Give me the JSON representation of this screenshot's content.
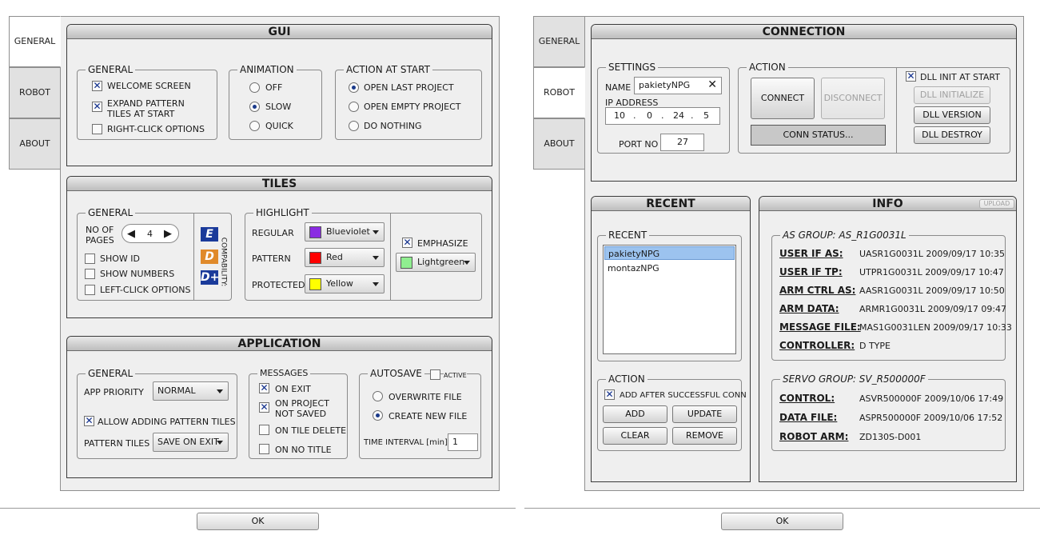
{
  "dialog_left": {
    "tabs": [
      {
        "label": "GENERAL",
        "active": true
      },
      {
        "label": "ROBOT",
        "active": false
      },
      {
        "label": "ABOUT",
        "active": false
      }
    ],
    "ok_label": "OK",
    "gui": {
      "title": "GUI",
      "general": {
        "title": "GENERAL",
        "welcome_screen": "WELCOME SCREEN",
        "expand_line1": "EXPAND PATTERN",
        "expand_line2": "TILES AT START",
        "right_click": "RIGHT-CLICK OPTIONS"
      },
      "animation": {
        "title": "ANIMATION",
        "off": "OFF",
        "slow": "SLOW",
        "quick": "QUICK",
        "selected": "SLOW"
      },
      "action_at_start": {
        "title": "ACTION AT START",
        "open_last": "OPEN LAST PROJECT",
        "open_empty": "OPEN EMPTY PROJECT",
        "do_nothing": "DO NOTHING",
        "selected": "OPEN LAST PROJECT"
      }
    },
    "tiles": {
      "title": "TILES",
      "general": {
        "title": "GENERAL",
        "no_of_pages_line1": "NO OF",
        "no_of_pages_line2": "PAGES",
        "pages_value": "4",
        "show_id": "SHOW ID",
        "show_numbers": "SHOW NUMBERS",
        "left_click": "LEFT-CLICK OPTIONS",
        "compatibility": "COMPABILITY:"
      },
      "highlight": {
        "title": "HIGHLIGHT",
        "regular_label": "REGULAR",
        "regular_value": "Blueviolet",
        "regular_color": "#8a2be2",
        "pattern_label": "PATTERN",
        "pattern_value": "Red",
        "pattern_color": "#ff0000",
        "protected_label": "PROTECTED",
        "protected_value": "Yellow",
        "protected_color": "#ffff00",
        "emphasize_label": "EMPHASIZE",
        "emphasize_value": "Lightgreen",
        "emphasize_color": "#90ee90"
      }
    },
    "application": {
      "title": "APPLICATION",
      "general": {
        "title": "GENERAL",
        "app_priority_label": "APP PRIORITY",
        "app_priority_value": "NORMAL",
        "allow_adding": "ALLOW ADDING PATTERN TILES",
        "pattern_tiles_label": "PATTERN TILES",
        "pattern_tiles_value": "SAVE ON EXIT"
      },
      "messages": {
        "title": "MESSAGES",
        "on_exit": "ON EXIT",
        "on_project_line1": "ON PROJECT",
        "on_project_line2": "NOT SAVED",
        "on_tile_delete": "ON TILE DELETE",
        "on_no_title": "ON NO TITLE"
      },
      "autosave": {
        "title": "AUTOSAVE",
        "active_label": "ACTIVE",
        "overwrite": "OVERWRITE FILE",
        "create_new": "CREATE NEW FILE",
        "selected": "CREATE NEW FILE",
        "interval_label": "TIME INTERVAL [min]",
        "interval_value": "1"
      }
    }
  },
  "dialog_right": {
    "tabs": [
      {
        "label": "GENERAL",
        "active": false
      },
      {
        "label": "ROBOT",
        "active": true
      },
      {
        "label": "ABOUT",
        "active": false
      }
    ],
    "ok_label": "OK",
    "connection": {
      "title": "CONNECTION",
      "settings": {
        "title": "SETTINGS",
        "name_label": "NAME",
        "name_value": "pakietyNPG",
        "ip_label": "IP ADDRESS",
        "ip": [
          "10",
          "0",
          "24",
          "5"
        ],
        "port_label": "PORT NO",
        "port_value": "27"
      },
      "action": {
        "title": "ACTION",
        "connect": "CONNECT",
        "disconnect": "DISCONNECT",
        "conn_status": "CONN STATUS...",
        "dll_init_at_start": "DLL INIT AT START",
        "dll_initialize": "DLL INITIALIZE",
        "dll_version": "DLL VERSION",
        "dll_destroy": "DLL DESTROY"
      }
    },
    "recent": {
      "title": "RECENT",
      "list_title": "RECENT",
      "items": [
        "pakietyNPG",
        "montazNPG"
      ],
      "action_title": "ACTION",
      "add_after": "ADD AFTER SUCCESSFUL CONN",
      "add": "ADD",
      "update": "UPDATE",
      "clear": "CLEAR",
      "remove": "REMOVE"
    },
    "info": {
      "title": "INFO",
      "upload": "UPLOAD",
      "as_group_title": "AS GROUP: AS_R1G0031L",
      "as_rows": [
        {
          "key": "USER IF AS:",
          "value": "UASR1G0031L 2009/09/17 10:35"
        },
        {
          "key": "USER IF TP:",
          "value": "UTPR1G0031L 2009/09/17 10:47"
        },
        {
          "key": "ARM CTRL AS:",
          "value": "AASR1G0031L 2009/09/17 10:50"
        },
        {
          "key": "ARM DATA:",
          "value": "ARMR1G0031L 2009/09/17 09:47"
        },
        {
          "key": "MESSAGE FILE:",
          "value": "MAS1G0031LEN 2009/09/17 10:33"
        },
        {
          "key": "CONTROLLER:",
          "value": "D TYPE"
        }
      ],
      "servo_group_title": "SERVO GROUP: SV_R500000F",
      "servo_rows": [
        {
          "key": "CONTROL:",
          "value": "ASVR500000F 2009/10/06 17:49"
        },
        {
          "key": "DATA FILE:",
          "value": "ASPR500000F 2009/10/06 17:52"
        },
        {
          "key": "ROBOT ARM:",
          "value": "ZD130S-D001"
        }
      ]
    }
  }
}
